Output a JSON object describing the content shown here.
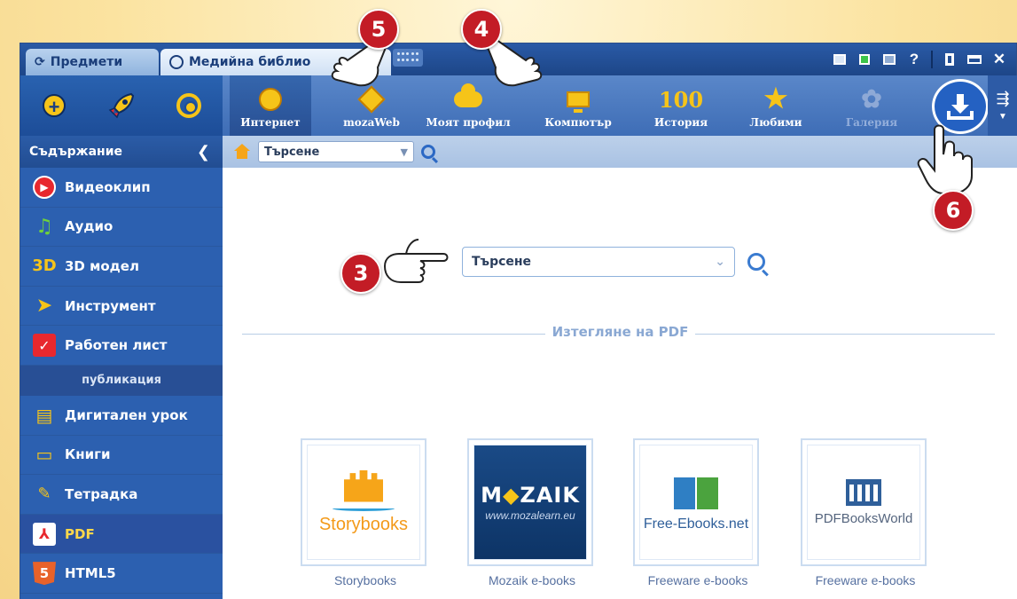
{
  "titlebar": {
    "tabs": [
      {
        "label": "Предмети"
      },
      {
        "label": "Медийна библио"
      }
    ]
  },
  "toolbar": {
    "items": [
      {
        "label": "Интернет",
        "icon": "internet-icon",
        "active": true
      },
      {
        "label": "mozaWeb",
        "icon": "mozaweb-diamond-icon"
      },
      {
        "label": "Моят профил",
        "icon": "cloud-profile-icon"
      },
      {
        "label": "Компютър",
        "icon": "monitor-icon"
      },
      {
        "label": "История",
        "icon": "history-100-icon",
        "glyph": "100"
      },
      {
        "label": "Любими",
        "icon": "star-icon"
      },
      {
        "label": "Галерия",
        "icon": "gallery-icon",
        "disabled": true
      }
    ],
    "download_icon": "download-icon",
    "export_icon": "export-icon"
  },
  "sidebar": {
    "header": "Съдържание",
    "items": [
      {
        "label": "Видеоклип",
        "icon": "video-icon"
      },
      {
        "label": "Аудио",
        "icon": "audio-icon"
      },
      {
        "label": "3D модел",
        "icon": "3d-model-icon",
        "glyph": "3D"
      },
      {
        "label": "Инструмент",
        "icon": "tool-icon"
      },
      {
        "label": "Работен лист",
        "icon": "worksheet-icon"
      }
    ],
    "section": "публикация",
    "items2": [
      {
        "label": "Дигитален урок",
        "icon": "digital-lesson-icon"
      },
      {
        "label": "Книги",
        "icon": "books-icon"
      },
      {
        "label": "Тетрадка",
        "icon": "notebook-icon"
      },
      {
        "label": "PDF",
        "icon": "pdf-icon",
        "active": true
      },
      {
        "label": "HTML5",
        "icon": "html5-icon"
      }
    ]
  },
  "breadcrumb": {
    "select_value": "Търсене"
  },
  "main": {
    "search_value": "Търсене",
    "divider_label": "Изтегляне на PDF",
    "cards": [
      {
        "logo_text": "Storybooks",
        "caption": "Storybooks"
      },
      {
        "logo_title_a": "M",
        "logo_title_b": "◆",
        "logo_title_c": "ZAIK",
        "logo_sub": "www.mozalearn.eu",
        "caption": "Mozaik e-books"
      },
      {
        "logo_text": "Free-Ebooks.net",
        "caption": "Freeware e-books"
      },
      {
        "logo_text": "PDFBooksWorld",
        "caption": "Freeware e-books"
      }
    ]
  },
  "callouts": [
    {
      "number": "3"
    },
    {
      "number": "4"
    },
    {
      "number": "5"
    },
    {
      "number": "6"
    }
  ],
  "colors": {
    "accent": "#f6c419",
    "badge": "#c31c26",
    "window_blue": "#2c60b0"
  }
}
